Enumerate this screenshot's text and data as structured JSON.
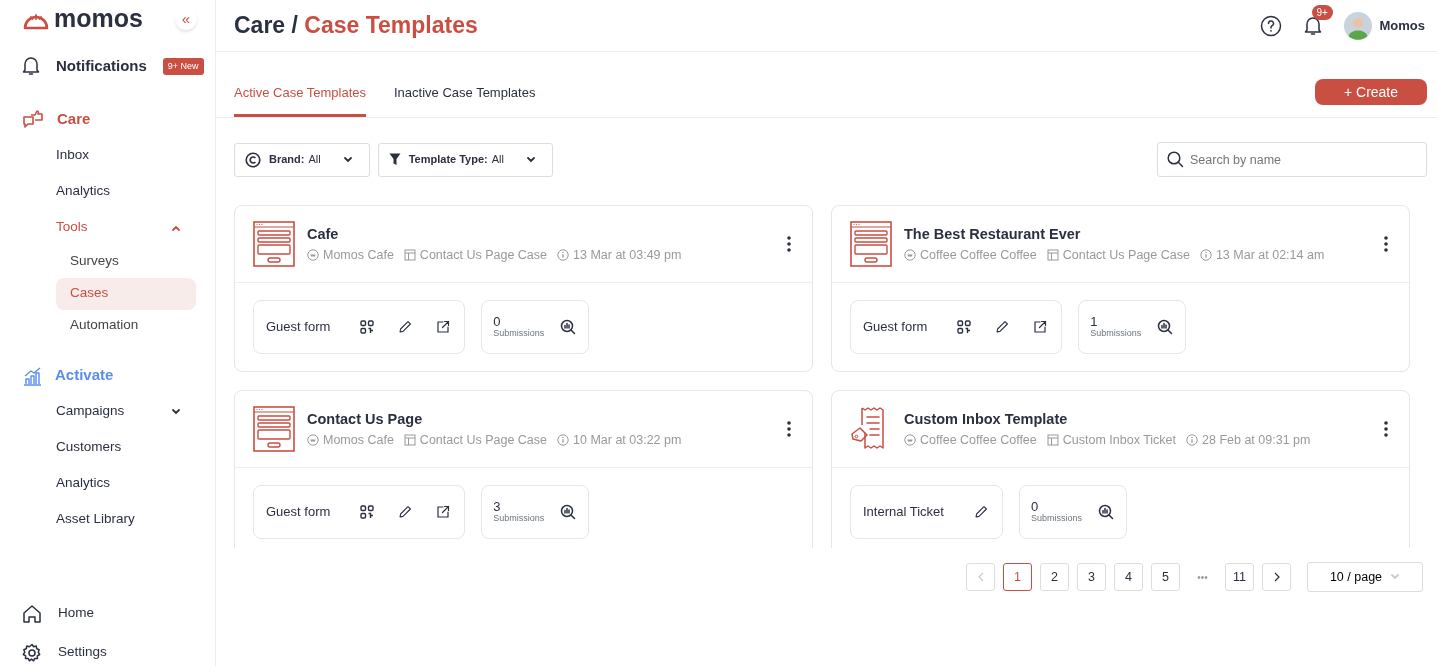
{
  "sidebar": {
    "logo": "momos",
    "collapse": "«",
    "notifications": {
      "label": "Notifications",
      "badge": "9+ New"
    },
    "sections": [
      {
        "label": "Care",
        "kind": "care",
        "color": "#c94f43",
        "items": [
          {
            "label": "Inbox",
            "selected": false
          },
          {
            "label": "Analytics",
            "selected": false
          },
          {
            "label": "Tools",
            "selected": false,
            "expanded": true,
            "children": [
              {
                "label": "Surveys",
                "selected": false
              },
              {
                "label": "Cases",
                "selected": true
              },
              {
                "label": "Automation",
                "selected": false
              }
            ]
          }
        ]
      },
      {
        "label": "Activate",
        "kind": "activate",
        "color": "#5b8def",
        "items": [
          {
            "label": "Campaigns",
            "selected": false,
            "expanded": false
          },
          {
            "label": "Customers",
            "selected": false
          },
          {
            "label": "Analytics",
            "selected": false
          },
          {
            "label": "Asset Library",
            "selected": false
          }
        ]
      }
    ],
    "footer": [
      {
        "label": "Home",
        "kind": "home"
      },
      {
        "label": "Settings",
        "kind": "settings"
      }
    ]
  },
  "header": {
    "breadcrumb": [
      "Care /",
      "Case Templates"
    ],
    "notification_badge": "9+",
    "user": "Momos"
  },
  "tabs": [
    {
      "label": "Active Case Templates",
      "selected": true
    },
    {
      "label": "Inactive Case Templates",
      "selected": false
    }
  ],
  "create_button": "+ Create",
  "filters": [
    {
      "kind": "brand",
      "label": "Brand:",
      "value": "All"
    },
    {
      "kind": "type",
      "label": "Template Type:",
      "value": "All"
    }
  ],
  "search": {
    "placeholder": "Search by name"
  },
  "templates": [
    {
      "kind": "form",
      "title": "Cafe",
      "brand": "Momos Cafe",
      "type": "Contact Us Page Case",
      "date": "13 Mar at 03:49 pm",
      "link": {
        "label": "Guest form",
        "qr": true,
        "edit": true,
        "open": true
      },
      "submissions": {
        "count": "0",
        "label": "Submissions"
      }
    },
    {
      "kind": "form",
      "title": "The Best Restaurant Ever",
      "brand": "Coffee Coffee Coffee",
      "type": "Contact Us Page Case",
      "date": "13 Mar at 02:14 am",
      "link": {
        "label": "Guest form",
        "qr": true,
        "edit": true,
        "open": true
      },
      "submissions": {
        "count": "1",
        "label": "Submissions"
      }
    },
    {
      "kind": "form",
      "title": "Contact Us Page",
      "brand": "Momos Cafe",
      "type": "Contact Us Page Case",
      "date": "10 Mar at 03:22 pm",
      "link": {
        "label": "Guest form",
        "qr": true,
        "edit": true,
        "open": true
      },
      "submissions": {
        "count": "3",
        "label": "Submissions"
      }
    },
    {
      "kind": "ticket",
      "title": "Custom Inbox Template",
      "brand": "Coffee Coffee Coffee",
      "type": "Custom Inbox Ticket",
      "date": "28 Feb at 09:31 pm",
      "link": {
        "label": "Internal Ticket",
        "qr": false,
        "edit": true,
        "open": false
      },
      "submissions": {
        "count": "0",
        "label": "Submissions"
      }
    }
  ],
  "pagination": {
    "prev_disabled": true,
    "pages": [
      {
        "label": "1",
        "selected": true
      },
      {
        "label": "2",
        "selected": false
      },
      {
        "label": "3",
        "selected": false
      },
      {
        "label": "4",
        "selected": false
      },
      {
        "label": "5",
        "selected": false
      },
      {
        "label": "•••",
        "kind": "ellipsis"
      },
      {
        "label": "11",
        "selected": false
      }
    ],
    "page_size": "10 / page"
  }
}
